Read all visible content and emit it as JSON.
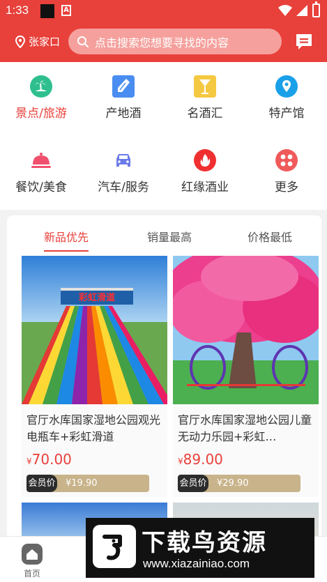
{
  "status_bar": {
    "time": "1:33",
    "notif_letter": "A"
  },
  "header": {
    "location": "张家口",
    "search_placeholder": "点击搜索您想要寻找的内容",
    "accent": "#e8403a"
  },
  "categories": [
    {
      "label": "景点/旅游",
      "icon": "island-icon",
      "color": "#2fbf8f",
      "active": true
    },
    {
      "label": "产地酒",
      "icon": "bottle-icon",
      "color": "#4a8df0"
    },
    {
      "label": "名酒汇",
      "icon": "wine-glass-icon",
      "color": "#f5c841"
    },
    {
      "label": "特产馆",
      "icon": "map-pin-icon",
      "color": "#1aa0e8"
    },
    {
      "label": "餐饮/美食",
      "icon": "food-cover-icon",
      "color": "#f0506e"
    },
    {
      "label": "汽车/服务",
      "icon": "car-icon",
      "color": "#6a7be8"
    },
    {
      "label": "红缘酒业",
      "icon": "flame-icon",
      "color": "#f03030"
    },
    {
      "label": "更多",
      "icon": "more-grid-icon",
      "color": "#f05a5a"
    }
  ],
  "tabs": [
    {
      "label": "新品优先",
      "active": true
    },
    {
      "label": "销量最高"
    },
    {
      "label": "价格最低"
    }
  ],
  "products": [
    {
      "image": "rainbow-slide-photo",
      "image_caption": "彩虹滑道",
      "title": "官厅水库国家湿地公园观光电瓶车+彩虹滑道",
      "currency": "¥",
      "price": "70.00",
      "member_label": "会员价",
      "member_price": "¥19.90"
    },
    {
      "image": "pink-tree-swing-photo",
      "title": "官厅水库国家湿地公园儿童无动力乐园+彩虹…",
      "currency": "¥",
      "price": "89.00",
      "member_label": "会员价",
      "member_price": "¥29.90"
    }
  ],
  "bottom_nav": {
    "home_label": "首页"
  },
  "watermark": {
    "title": "下载鸟资源",
    "url": "www.xiazainiao.com"
  }
}
